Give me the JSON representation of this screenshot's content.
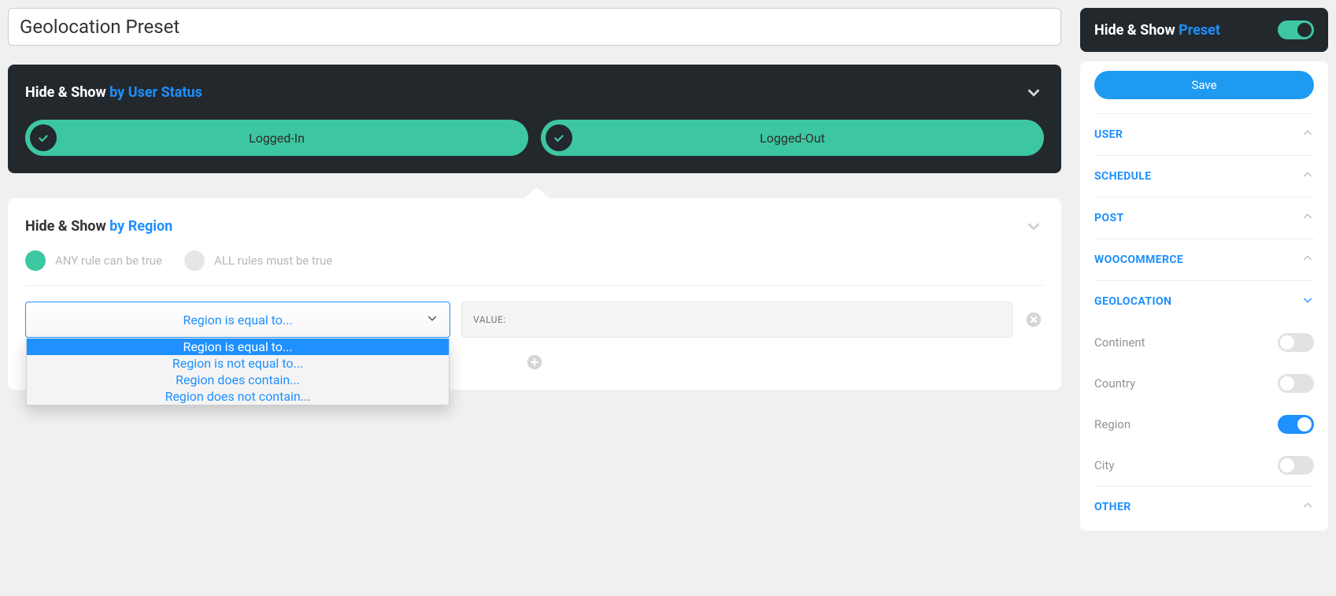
{
  "preset_name": "Geolocation Preset",
  "user_status_panel": {
    "title_prefix": "Hide & Show ",
    "title_accent": "by User Status",
    "pills": [
      {
        "label": "Logged-In"
      },
      {
        "label": "Logged-Out"
      }
    ]
  },
  "region_panel": {
    "title_prefix": "Hide & Show ",
    "title_accent": "by Region",
    "rule_mode_any": "ANY rule can be true",
    "rule_mode_all": "ALL rules must be true",
    "select_value": "Region is equal to...",
    "value_placeholder": "VALUE:",
    "options": [
      "Region is equal to...",
      "Region is not equal to...",
      "Region does contain...",
      "Region does not contain..."
    ]
  },
  "sidebar": {
    "header_prefix": "Hide & Show ",
    "header_accent": "Preset",
    "save_label": "Save",
    "sections": {
      "user": "USER",
      "schedule": "SCHEDULE",
      "post": "POST",
      "woocommerce": "WOOCOMMERCE",
      "geolocation": "GEOLOCATION",
      "other": "OTHER"
    },
    "geo_items": {
      "continent": "Continent",
      "country": "Country",
      "region": "Region",
      "city": "City"
    }
  }
}
